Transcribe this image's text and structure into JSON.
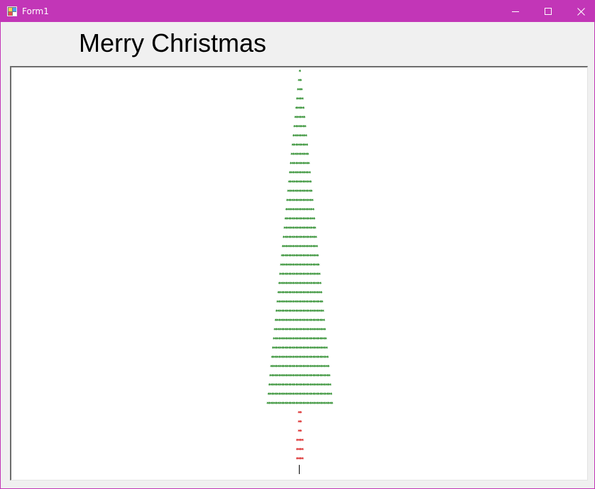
{
  "window": {
    "title": "Form1",
    "icon": "winforms-app-icon",
    "controls": [
      "minimize-icon",
      "maximize-icon",
      "close-icon"
    ],
    "accent_color": "#c236b7"
  },
  "heading": "Merry Christmas",
  "tree": {
    "leaf_color": "#0a7a0a",
    "trunk_color": "#d40000",
    "leaf_lines": [
      "*",
      "**",
      "***",
      "****",
      "*****",
      "******",
      "*******",
      "********",
      "*********",
      "**********",
      "***********",
      "************",
      "*************",
      "**************",
      "***************",
      "****************",
      "*****************",
      "******************",
      "*******************",
      "********************",
      "*********************",
      "**********************",
      "***********************",
      "************************",
      "*************************",
      "**************************",
      "***************************",
      "****************************",
      "*****************************",
      "******************************",
      "*******************************",
      "********************************",
      "*********************************",
      "**********************************",
      "***********************************",
      "************************************",
      "*************************************"
    ],
    "trunk_lines": [
      "**",
      "**",
      "**",
      "****",
      "****",
      "****"
    ]
  }
}
